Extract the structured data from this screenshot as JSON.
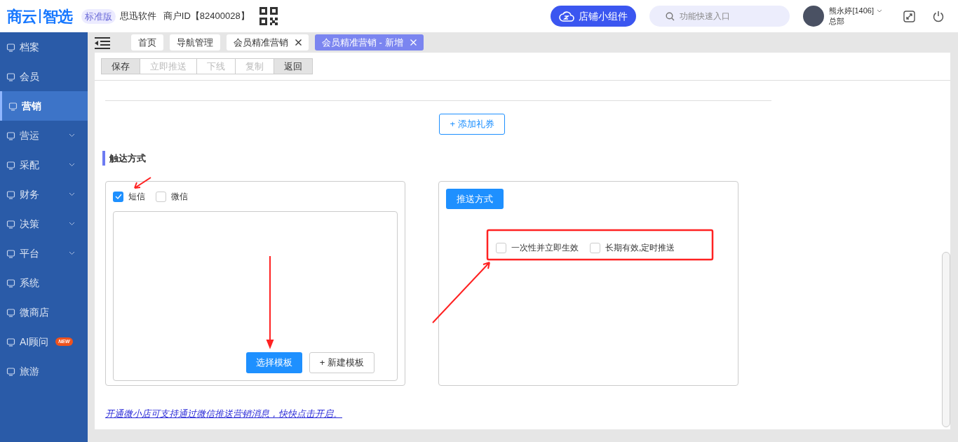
{
  "header": {
    "logo": [
      "商云",
      "智选"
    ],
    "edition": "标准版",
    "company": "思迅软件",
    "merchant_id": "商户ID【82400028】",
    "widget_button": "店铺小组件",
    "search": {
      "placeholder": "功能快速入口"
    },
    "user": {
      "name": "熊永婷[1406]",
      "dept": "总部"
    }
  },
  "sidebar": {
    "items": [
      {
        "label": "档案",
        "selected": false,
        "expandable": false
      },
      {
        "label": "会员",
        "selected": false,
        "expandable": false
      },
      {
        "label": "营销",
        "selected": true,
        "expandable": false
      },
      {
        "label": "营运",
        "selected": false,
        "expandable": true
      },
      {
        "label": "采配",
        "selected": false,
        "expandable": true
      },
      {
        "label": "财务",
        "selected": false,
        "expandable": true
      },
      {
        "label": "决策",
        "selected": false,
        "expandable": true
      },
      {
        "label": "平台",
        "selected": false,
        "expandable": true
      },
      {
        "label": "系统",
        "selected": false,
        "expandable": false
      },
      {
        "label": "微商店",
        "selected": false,
        "expandable": false
      },
      {
        "label": "AI顾问",
        "selected": false,
        "expandable": false,
        "badge": "NEW"
      },
      {
        "label": "旅游",
        "selected": false,
        "expandable": false
      }
    ]
  },
  "tabs": [
    {
      "label": "首页",
      "selected": false,
      "closable": false
    },
    {
      "label": "导航管理",
      "selected": false,
      "closable": false
    },
    {
      "label": "会员精准营销",
      "selected": false,
      "closable": true
    },
    {
      "label": "会员精准营销 - 新增",
      "selected": true,
      "closable": true
    }
  ],
  "toolbar": [
    {
      "label": "保存",
      "disabled": false
    },
    {
      "label": "立即推送",
      "disabled": true
    },
    {
      "label": "下线",
      "disabled": true
    },
    {
      "label": "复制",
      "disabled": true
    },
    {
      "label": "返回",
      "disabled": false
    }
  ],
  "add_coupon_button": "+ 添加礼券",
  "section_title": "触达方式",
  "channels": [
    {
      "label": "短信",
      "checked": true
    },
    {
      "label": "微信",
      "checked": false
    }
  ],
  "template_buttons": [
    "选择模板",
    "+ 新建模板"
  ],
  "push_method_button": "推送方式",
  "push_options": [
    {
      "label": "一次性并立即生效",
      "checked": false
    },
    {
      "label": "长期有效,定时推送",
      "checked": false
    }
  ],
  "footer_link": "开通微小店可支持通过微信推送营销消息，快快点击开启。"
}
